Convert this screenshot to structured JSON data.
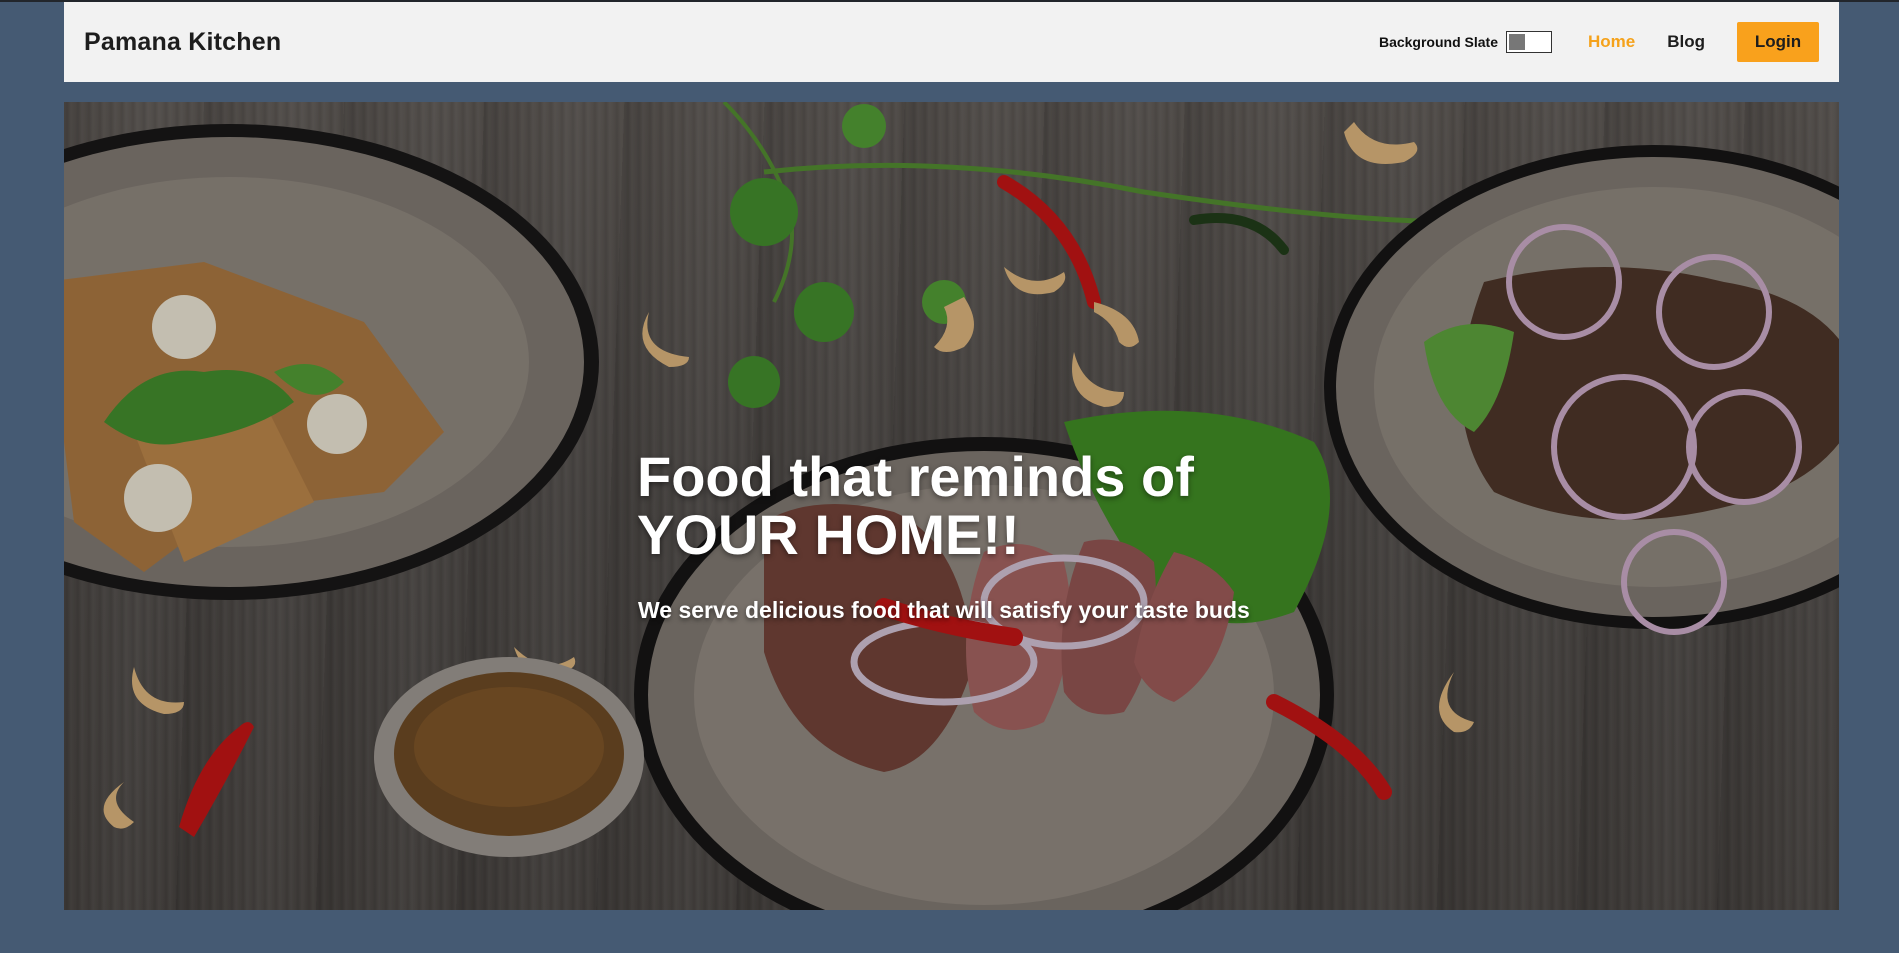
{
  "navbar": {
    "brand": "Pamana Kitchen",
    "toggle_label": "Background Slate",
    "links": [
      {
        "label": "Home",
        "active": true
      },
      {
        "label": "Blog",
        "active": false
      }
    ],
    "login_label": "Login"
  },
  "hero": {
    "title_line1": "Food that reminds of",
    "title_line2": "YOUR HOME!!",
    "subtitle": "We serve delicious food that will satisfy your taste buds",
    "image": "food-plates-photo"
  },
  "colors": {
    "page_bg": "#455a73",
    "navbar_bg": "#f2f2f2",
    "accent": "#f9a11c",
    "active_link": "#f5a21b"
  }
}
